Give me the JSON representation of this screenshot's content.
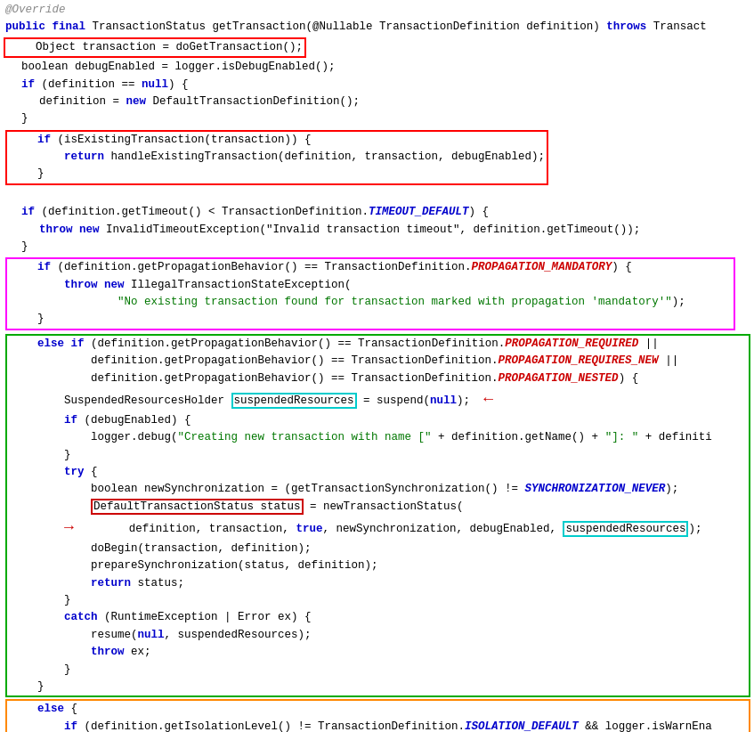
{
  "code": {
    "annotation": "@Override",
    "title": "public final TransactionStatus getTransaction(@Nullable TransactionDefinition definition) throws Transact"
  }
}
